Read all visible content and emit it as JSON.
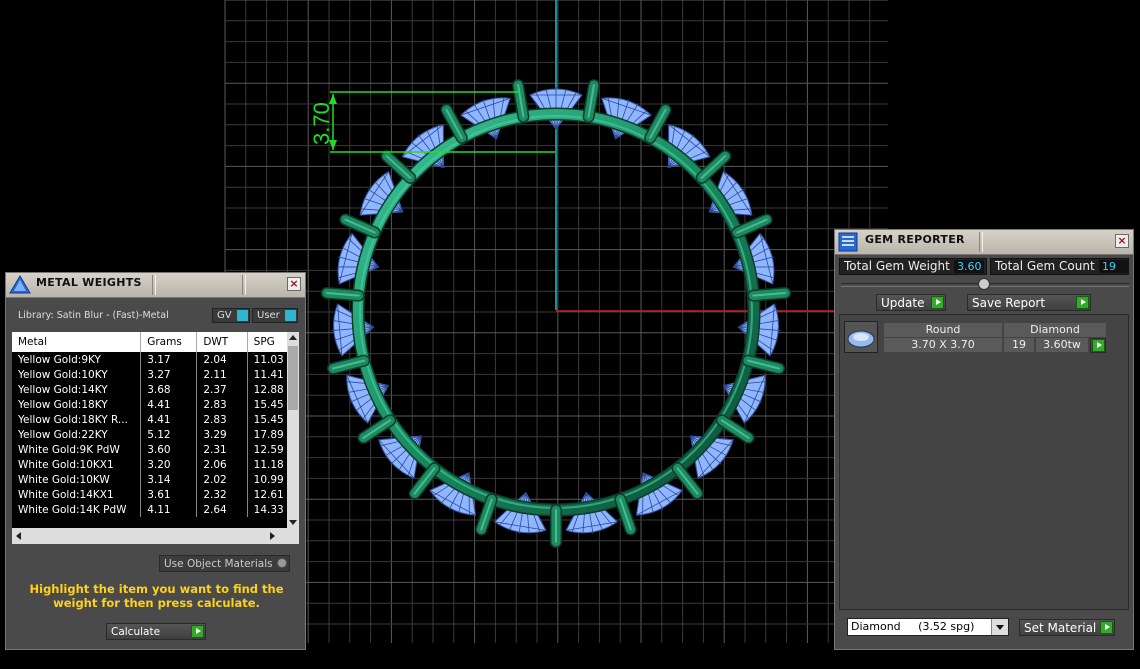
{
  "viewport": {
    "dimension_label": "3.70",
    "colors": {
      "grid": "#3a3a3a",
      "gridMajor": "#5a5a5a",
      "axisX": "#cc1f1f",
      "axisY": "#2bb7c4",
      "metal": "#1e8a62",
      "gem": "#8fb6ff",
      "dimension": "#22dd22"
    },
    "gem_count": 19
  },
  "metal_weights": {
    "title": "METAL WEIGHTS",
    "library": "Library: Satin Blur - (Fast)-Metal",
    "gv_label": "GV",
    "user_label": "User",
    "columns": [
      "Metal",
      "Grams",
      "DWT",
      "SPG"
    ],
    "rows": [
      [
        "Yellow Gold:9KY",
        "3.17",
        "2.04",
        "11.03"
      ],
      [
        "Yellow Gold:10KY",
        "3.27",
        "2.11",
        "11.41"
      ],
      [
        "Yellow Gold:14KY",
        "3.68",
        "2.37",
        "12.88"
      ],
      [
        "Yellow Gold:18KY",
        "4.41",
        "2.83",
        "15.45"
      ],
      [
        "Yellow Gold:18KY R...",
        "4.41",
        "2.83",
        "15.45"
      ],
      [
        "Yellow Gold:22KY",
        "5.12",
        "3.29",
        "17.89"
      ],
      [
        "White Gold:9K PdW",
        "3.60",
        "2.31",
        "12.59"
      ],
      [
        "White Gold:10KX1",
        "3.20",
        "2.06",
        "11.18"
      ],
      [
        "White Gold:10KW",
        "3.14",
        "2.02",
        "10.99"
      ],
      [
        "White Gold:14KX1",
        "3.61",
        "2.32",
        "12.61"
      ],
      [
        "White Gold:14K PdW",
        "4.11",
        "2.64",
        "14.33"
      ]
    ],
    "use_object_materials": "Use Object Materials",
    "hint": "Highlight the item you want to find the weight for then press calculate.",
    "calculate_label": "Calculate"
  },
  "gem_reporter": {
    "title": "GEM REPORTER",
    "total_weight_label": "Total Gem Weight",
    "total_weight_value": "3.60",
    "total_count_label": "Total Gem Count",
    "total_count_value": "19",
    "update_label": "Update",
    "save_report_label": "Save Report",
    "gem": {
      "shape": "Round",
      "material": "Diamond",
      "size": "3.70 X 3.70",
      "count": "19",
      "weight": "3.60tw"
    },
    "material_select": "Diamond     (3.52 spg)",
    "set_material_label": "Set Material"
  }
}
